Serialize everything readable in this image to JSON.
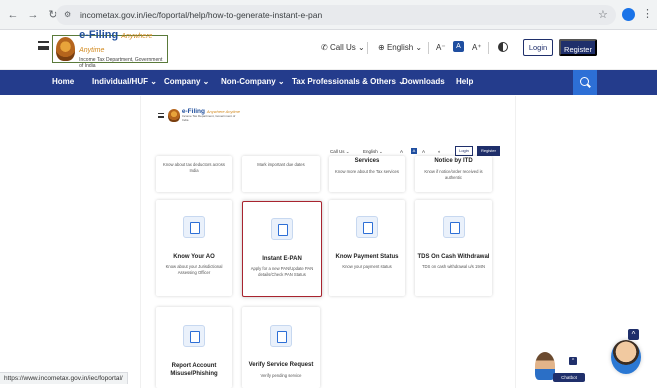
{
  "browser": {
    "url": "incometax.gov.in/iec/foportal/help/how-to-generate-instant-e-pan",
    "status_url": "https://www.incometax.gov.in/iec/foportal/"
  },
  "header": {
    "logo_title": "e-Filing",
    "logo_tagline": "Anywhere Anytime",
    "logo_subtitle": "Income Tax Department, Government of India",
    "call_us": "Call Us",
    "language": "English",
    "a_minus": "A⁻",
    "a_normal": "A",
    "a_plus": "A⁺",
    "login": "Login",
    "register": "Register"
  },
  "nav": {
    "items": [
      "Home",
      "Individual/HUF ⌄",
      "Company ⌄",
      "Non-Company ⌄",
      "Tax Professionals & Others ⌄",
      "Downloads",
      "Help"
    ]
  },
  "embedded": {
    "logo_title": "e-Filing",
    "logo_tagline": "Anywhere Anytime",
    "logo_subtitle": "Income Tax Department, Government of India",
    "call_us": "Call Us ⌄",
    "language": "English ⌄",
    "login": "Login",
    "register": "Register"
  },
  "cards_top": [
    {
      "title": "",
      "desc": "Know about tax deductors across India"
    },
    {
      "title": "",
      "desc": "Mark important due dates"
    },
    {
      "title": "Services",
      "desc": "Know more about the Tax services"
    },
    {
      "title": "Notice by ITD",
      "desc": "Know if notice/order received is authentic"
    }
  ],
  "cards_mid": [
    {
      "title": "Know Your AO",
      "desc": "Know about your Jurisdictional Assessing Officer"
    },
    {
      "title": "Instant E-PAN",
      "desc": "Apply for a new PAN/Update PAN details/Check PAN Status"
    },
    {
      "title": "Know Payment Status",
      "desc": "Know your payment status"
    },
    {
      "title": "TDS On Cash Withdrawal",
      "desc": "TDS on cash withdrawal u/s 194N"
    }
  ],
  "cards_bottom": [
    {
      "title": "Report Account Misuse/Phishing",
      "desc": ""
    },
    {
      "title": "Verify Service Request",
      "desc": "Verify pending service"
    }
  ],
  "chatbot": {
    "label": "Chatbot"
  },
  "colors": {
    "nav_bg": "#243c8c",
    "register_bg": "#1f2f6b",
    "highlight_border": "#a8242f",
    "search_bg": "#2d6fd6"
  }
}
